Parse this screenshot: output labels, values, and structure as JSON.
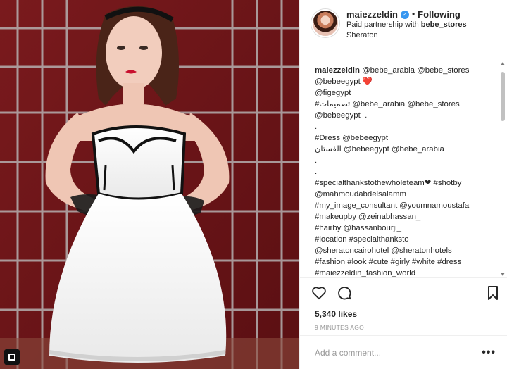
{
  "header": {
    "username": "maiezzeldin",
    "verified_icon": "verified-badge-icon",
    "separator": "•",
    "follow_status": "Following",
    "partnership_prefix": "Paid partnership with ",
    "partner": "bebe_stores",
    "location": "Sheraton"
  },
  "caption": {
    "author": "maiezzeldin",
    "text": " @bebe_arabia @bebe_stores\n@bebeegypt ❤️\n@figegypt\n#تصميمات @bebe_arabia @bebe_stores\n@bebeegypt ️ .\n.\n#Dress @bebeegypt\nالفستان @bebeegypt @bebe_arabia\n.\n.\n#specialthankstothewholeteam❤ #shotby\n@mahmoudabdelsalamm\n#my_image_consultant @youmnamoustafa\n#makeupby @zeinabhassan_\n#hairby @hassanbourji_\n#location #specialthanksto\n@sheratoncairohotel @sheratonhotels\n#fashion #look #cute #girly #white #dress\n#maiezzeldin_fashion_world\n#إطلالة"
  },
  "actions": {
    "like_icon": "heart-icon",
    "comment_icon": "comment-icon",
    "save_icon": "bookmark-icon"
  },
  "likes": "5,340 likes",
  "timestamp": "9 MINUTES AGO",
  "comment": {
    "placeholder": "Add a comment...",
    "more_icon": "more-options-icon",
    "more_label": "•••"
  },
  "colors": {
    "background_red": "#6e1417",
    "accent_blue": "#3897f0",
    "text": "#262626",
    "muted": "#999999"
  }
}
